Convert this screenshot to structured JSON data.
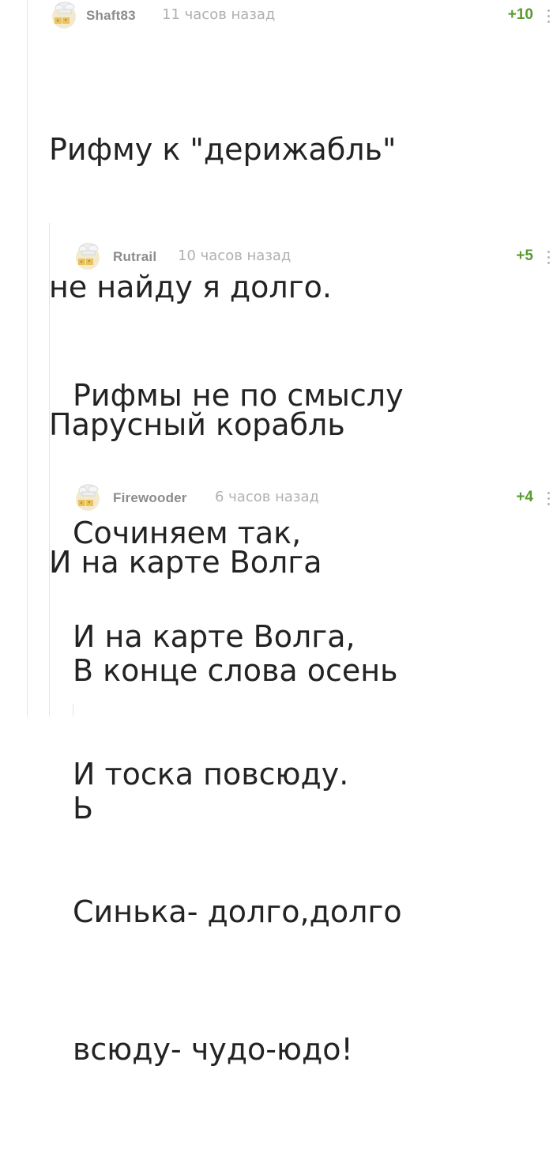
{
  "comments": [
    {
      "author": "Shaft83",
      "time": "11 часов назад",
      "rating": "+10",
      "avatar": "chef-hat-avatar",
      "lines": [
        "Рифму к \"дерижабль\"",
        "не найду я долго.",
        "Парусный корабль",
        "И на карте Волга"
      ]
    },
    {
      "author": "Rutrail",
      "time": "10 часов назад",
      "rating": "+5",
      "avatar": "chef-hat-avatar",
      "lines": [
        "Рифмы не по смыслу",
        "Сочиняем так,",
        "В конце слова осень",
        "Ь"
      ]
    },
    {
      "author": "Firewooder",
      "time": "6 часов назад",
      "rating": "+4",
      "avatar": "chef-hat-avatar",
      "lines": [
        "И на карте Волга,",
        "И тоска повсюду.",
        "Синька- долго,долго",
        "всюду- чудо-юдо!"
      ]
    }
  ],
  "colors": {
    "author": "#8c8c8c",
    "time": "#b0b0b0",
    "rating": "#5a9a2e",
    "text": "#232323",
    "thread_line": "#e4e4e4"
  }
}
